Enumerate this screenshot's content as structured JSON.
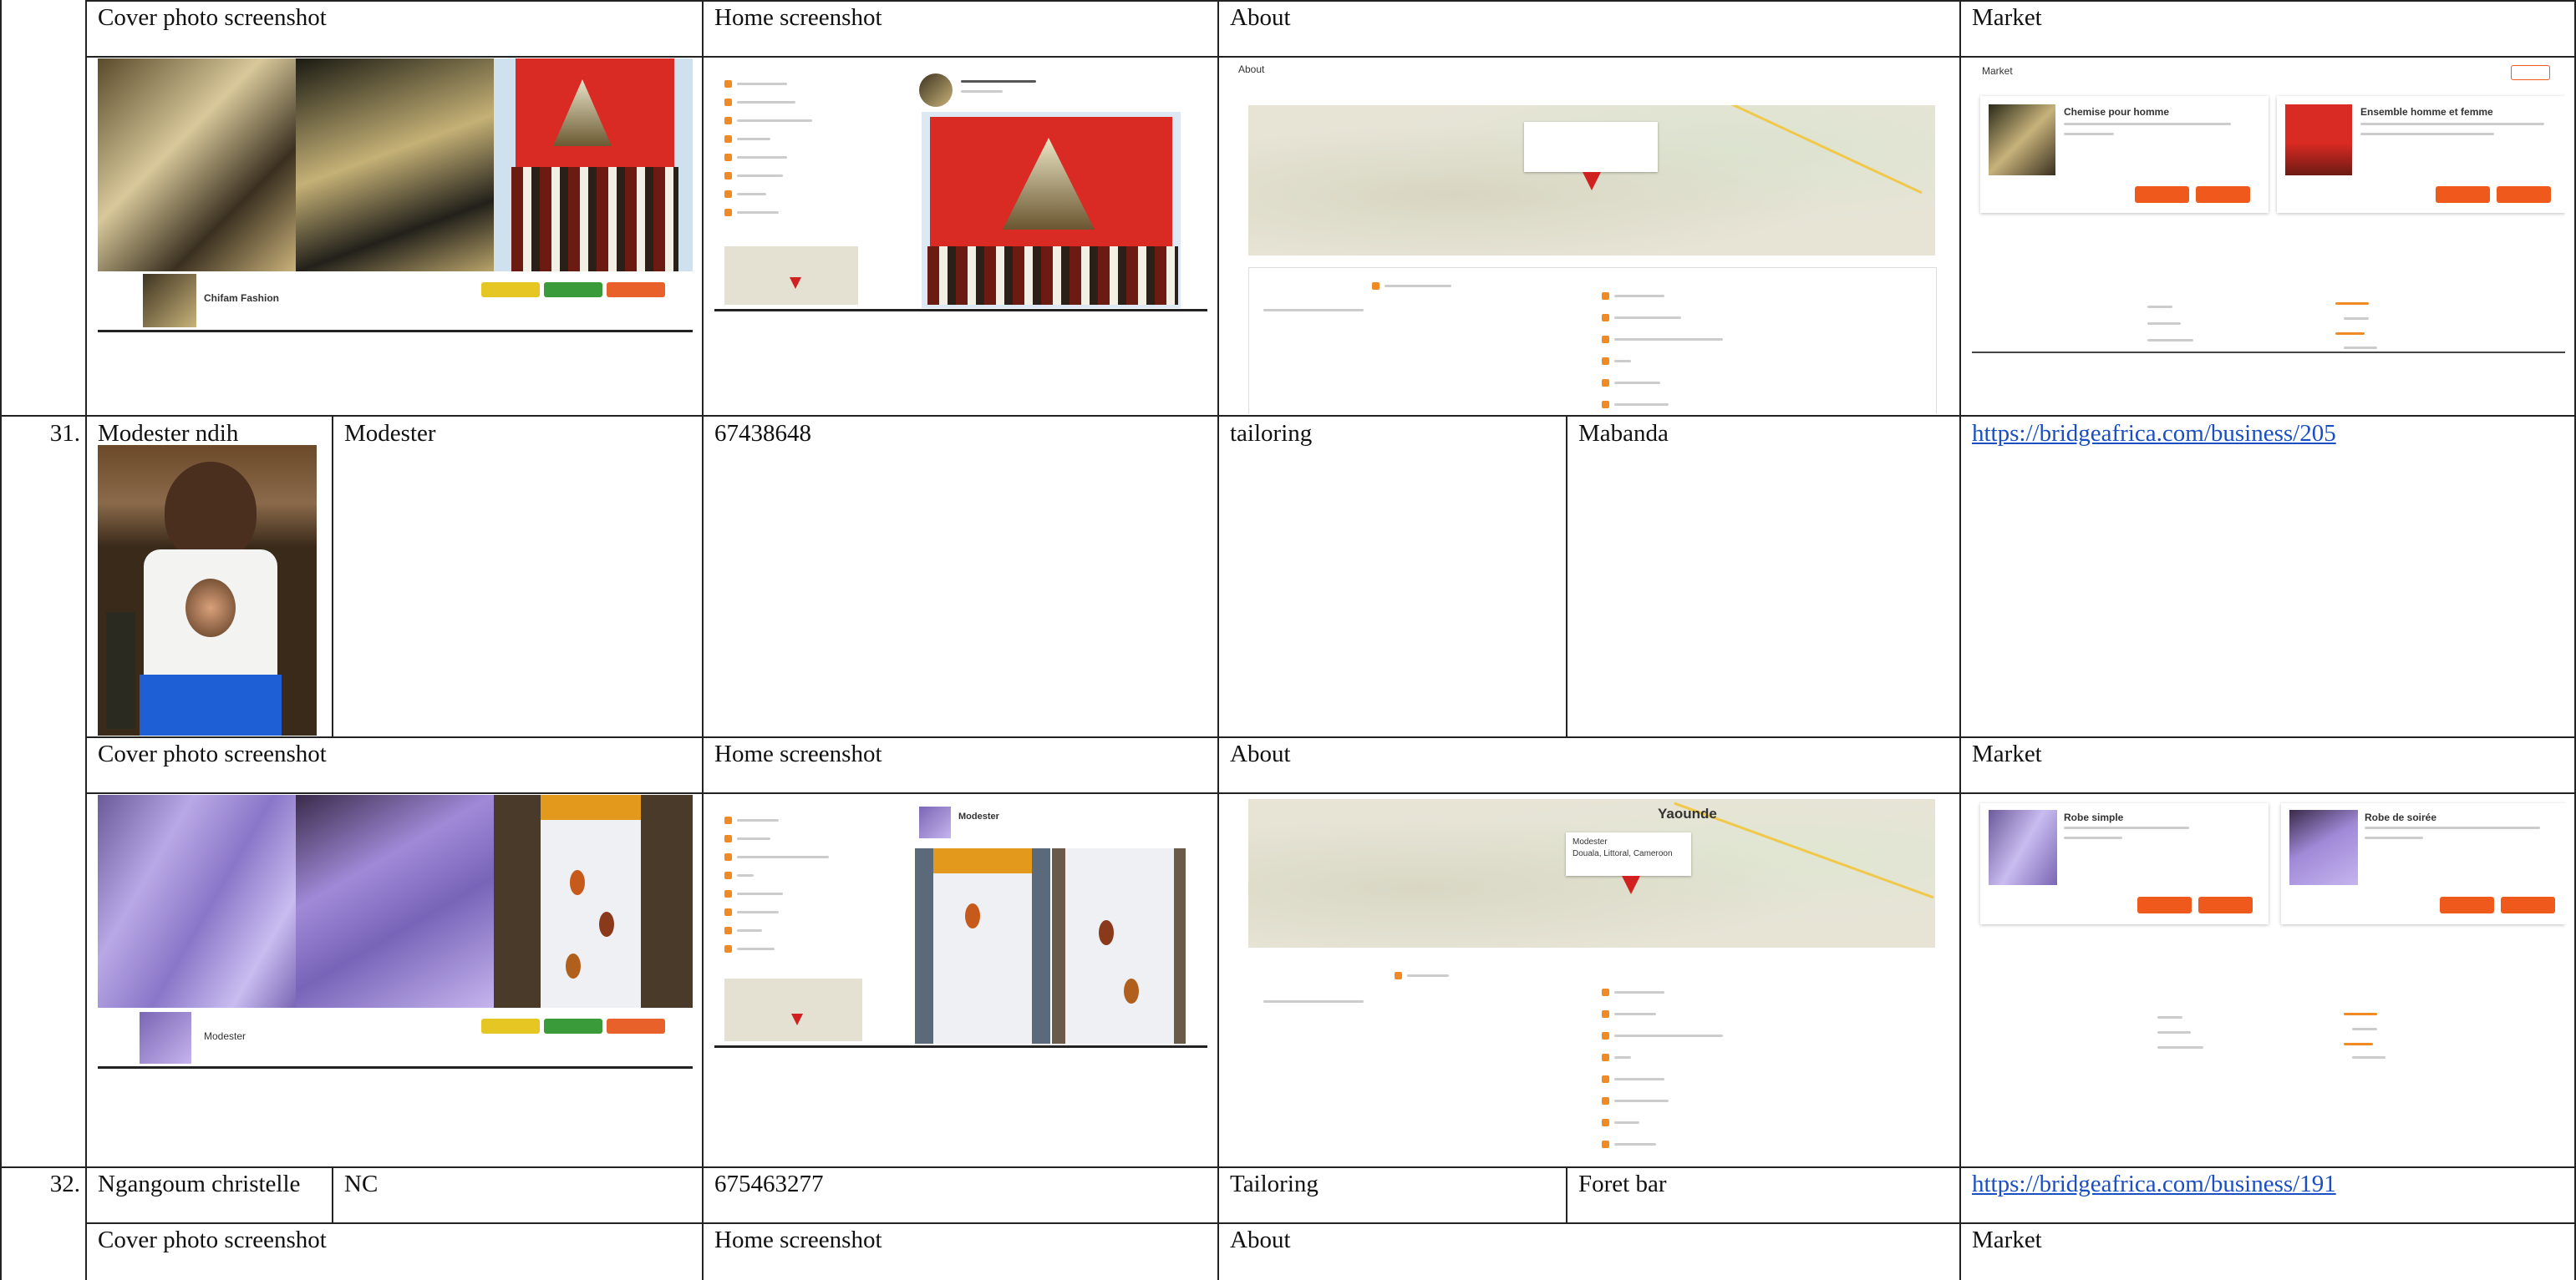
{
  "section_headers": {
    "cover": "Cover photo screenshot",
    "home": "Home screenshot",
    "about": "About",
    "market": "Market"
  },
  "rows": [
    {
      "number": "31.",
      "name": "Modester ndih",
      "short_name": "Modester",
      "phone": "67438648",
      "category": "tailoring",
      "location": "Mabanda",
      "url": "https://bridgeafrica.com/business/205",
      "map_city": "Yaounde"
    },
    {
      "number": "32.",
      "name": "Ngangoum christelle",
      "short_name": "NC",
      "phone": "675463277",
      "category": "Tailoring",
      "location": "Foret bar",
      "url": "https://bridgeafrica.com/business/191"
    }
  ],
  "screens_top": {
    "about_title": "About",
    "market_title": "Market",
    "product_1": "Chemise pour homme",
    "product_2": "Ensemble homme et femme",
    "profile_name": "Chifam Fashion"
  },
  "screens_mid": {
    "product_1": "Robe simple",
    "product_2": "Robe de soirée",
    "profile_name": "Modester",
    "map_label_line1": "Modester",
    "map_label_line2": "Douala, Littoral, Cameroon"
  },
  "colors": {
    "accent": "#ef5a1c",
    "link": "#1a4fc4"
  }
}
